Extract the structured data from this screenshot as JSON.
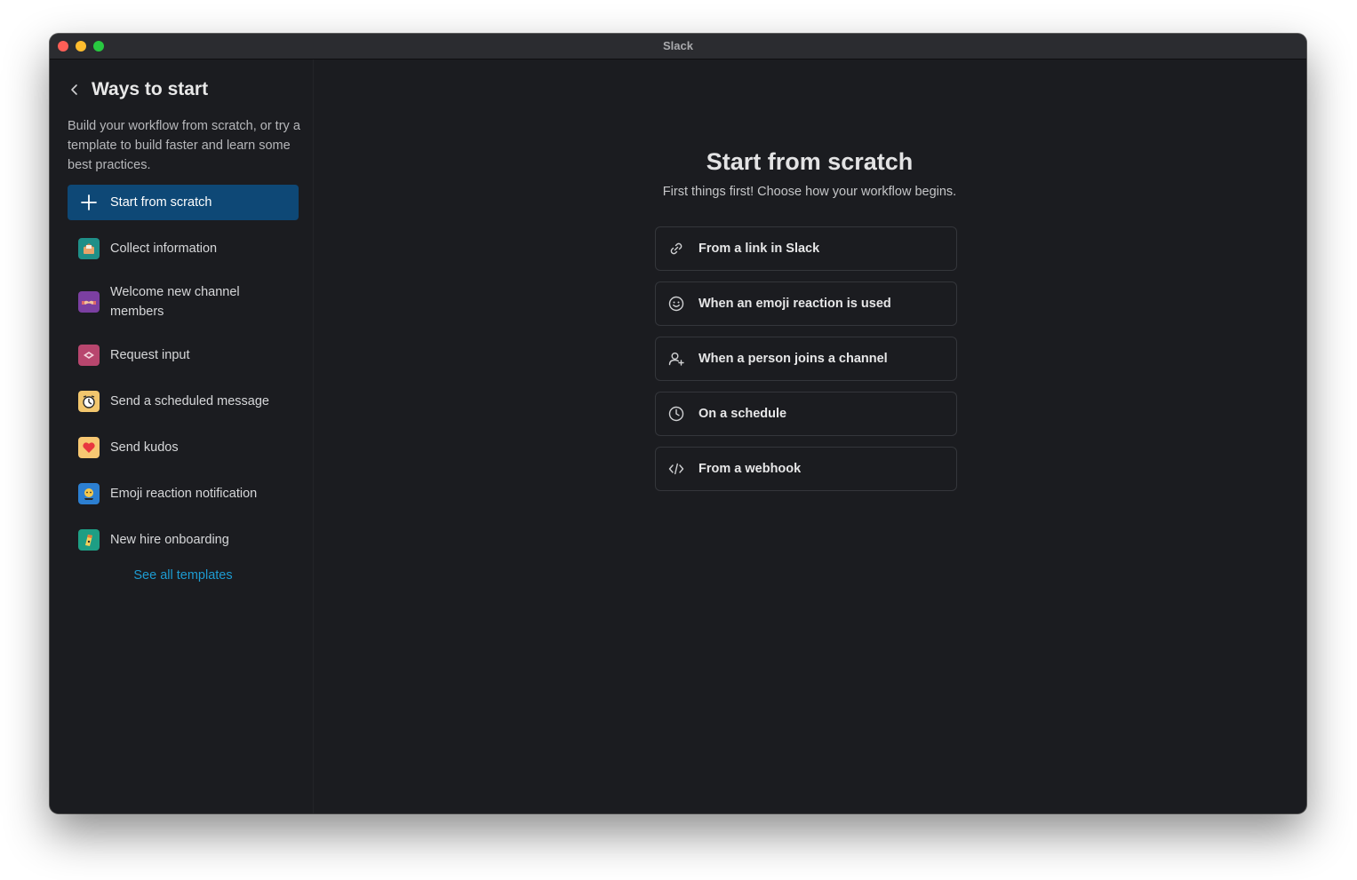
{
  "window": {
    "title": "Slack"
  },
  "sidebar": {
    "title": "Ways to start",
    "description": "Build your workflow from scratch, or try a template to build faster and learn some best practices.",
    "items": [
      {
        "label": "Start from scratch",
        "icon": "plus-icon"
      },
      {
        "label": "Collect information",
        "icon": "collect-information-icon"
      },
      {
        "label": "Welcome new channel members",
        "icon": "welcome-members-icon"
      },
      {
        "label": "Request input",
        "icon": "request-input-icon"
      },
      {
        "label": "Send a scheduled message",
        "icon": "scheduled-message-icon"
      },
      {
        "label": "Send kudos",
        "icon": "kudos-heart-icon"
      },
      {
        "label": "Emoji reaction notification",
        "icon": "emoji-notification-icon"
      },
      {
        "label": "New hire onboarding",
        "icon": "onboarding-icon"
      }
    ],
    "see_all": "See all templates"
  },
  "main": {
    "title": "Start from scratch",
    "subtitle": "First things first! Choose how your workflow begins.",
    "options": [
      {
        "label": "From a link in Slack",
        "icon": "link-icon"
      },
      {
        "label": "When an emoji reaction is used",
        "icon": "emoji-icon"
      },
      {
        "label": "When a person joins a channel",
        "icon": "person-add-icon"
      },
      {
        "label": "On a schedule",
        "icon": "clock-icon"
      },
      {
        "label": "From a webhook",
        "icon": "code-icon"
      }
    ]
  },
  "colors": {
    "background": "#1b1c20",
    "active_item": "#0e4876",
    "link": "#1d9bd1"
  }
}
